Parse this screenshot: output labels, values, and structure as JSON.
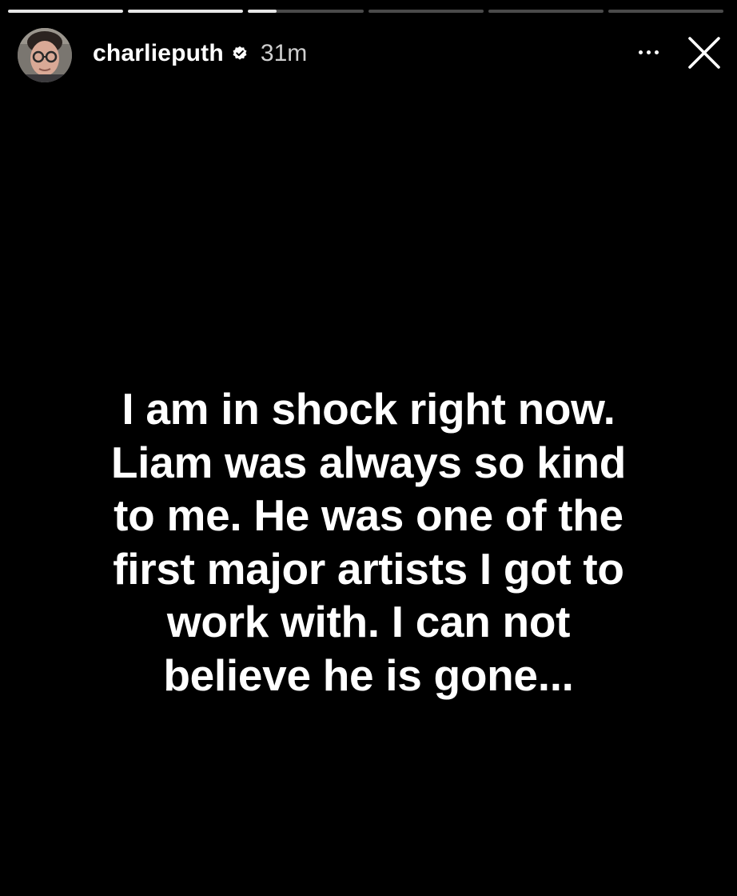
{
  "progress": {
    "segments": [
      1,
      1,
      0.25,
      0,
      0,
      0
    ]
  },
  "header": {
    "username": "charlieputh",
    "timestamp": "31m",
    "verified_icon": "verified-badge-icon",
    "more_icon": "more-horizontal-icon",
    "close_icon": "close-icon"
  },
  "story": {
    "text": "I am in shock right now.\nLiam was always so kind\nto me. He was one of the\nfirst major artists I got to\nwork with. I can not\nbelieve he is gone..."
  },
  "colors": {
    "background": "#000000",
    "text": "#ffffff",
    "progress_track": "#4a4a4a",
    "progress_fill": "#e6e6e6"
  }
}
